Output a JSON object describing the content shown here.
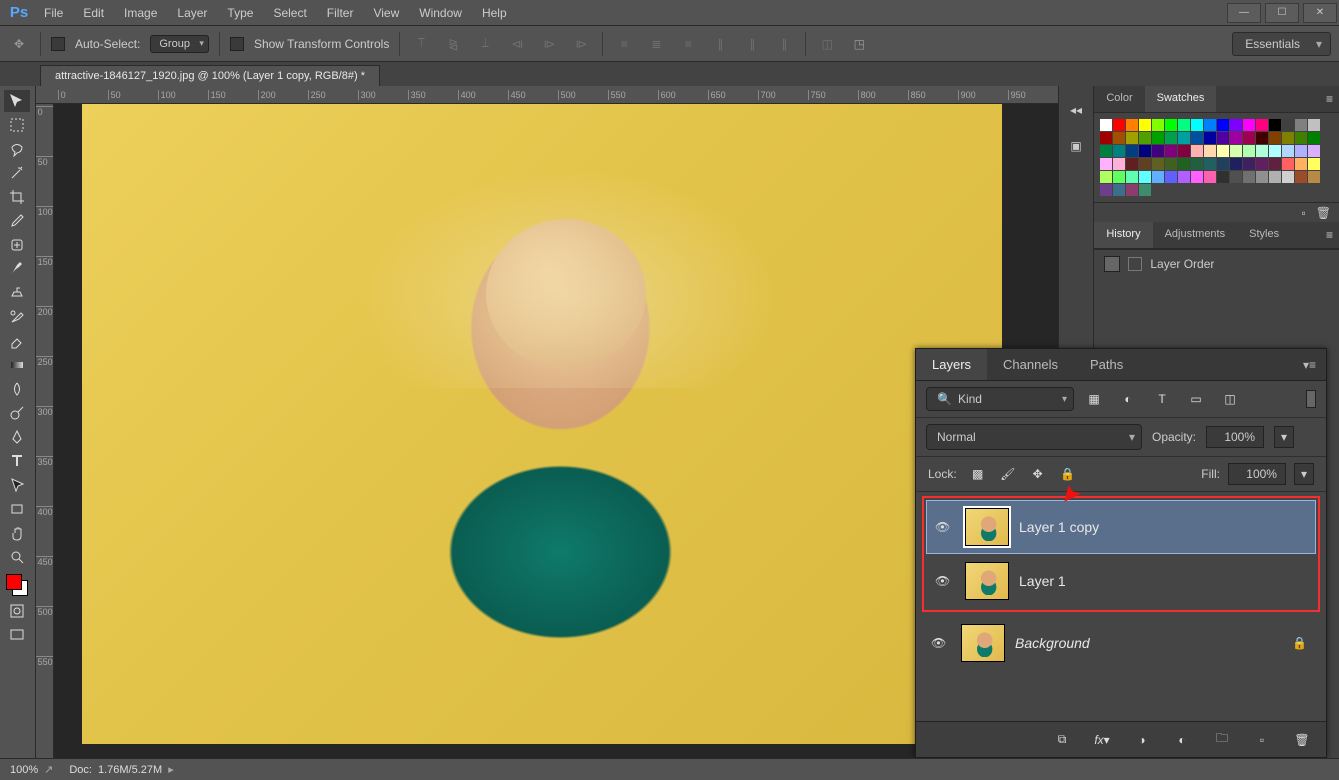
{
  "menu": {
    "items": [
      "File",
      "Edit",
      "Image",
      "Layer",
      "Type",
      "Select",
      "Filter",
      "View",
      "Window",
      "Help"
    ]
  },
  "options_bar": {
    "auto_select_label": "Auto-Select:",
    "auto_select_value": "Group",
    "show_transform_label": "Show Transform Controls"
  },
  "workspace": {
    "value": "Essentials"
  },
  "document": {
    "tab_title": "attractive-1846127_1920.jpg @ 100% (Layer 1 copy, RGB/8#) *"
  },
  "ruler": {
    "h": [
      "0",
      "50",
      "100",
      "150",
      "200",
      "250",
      "300",
      "350",
      "400",
      "450",
      "500",
      "550",
      "600",
      "650",
      "700",
      "750",
      "800",
      "850",
      "900",
      "950"
    ],
    "v": [
      "0",
      "50",
      "100",
      "150",
      "200",
      "250",
      "300",
      "350",
      "400",
      "450",
      "500",
      "550"
    ]
  },
  "panels": {
    "color_tabs": [
      "Color",
      "Swatches"
    ],
    "history_tabs": [
      "History",
      "Adjustments",
      "Styles"
    ],
    "history_item": "Layer Order"
  },
  "swatch_colors": [
    "#ffffff",
    "#ff0000",
    "#ff8000",
    "#ffff00",
    "#80ff00",
    "#00ff00",
    "#00ff80",
    "#00ffff",
    "#0080ff",
    "#0000ff",
    "#8000ff",
    "#ff00ff",
    "#ff0080",
    "#000000",
    "#404040",
    "#808080",
    "#c0c0c0",
    "#a00000",
    "#a05000",
    "#a0a000",
    "#50a000",
    "#00a000",
    "#00a050",
    "#00a0a0",
    "#0050a0",
    "#0000a0",
    "#5000a0",
    "#a000a0",
    "#a00050",
    "#400000",
    "#804000",
    "#808000",
    "#408000",
    "#008000",
    "#008040",
    "#008080",
    "#004080",
    "#000080",
    "#400080",
    "#800080",
    "#800040",
    "#ffb0b0",
    "#ffd8b0",
    "#ffffb0",
    "#d8ffb0",
    "#b0ffb0",
    "#b0ffd8",
    "#b0ffff",
    "#b0d8ff",
    "#b0b0ff",
    "#d8b0ff",
    "#ffb0ff",
    "#ffb0d8",
    "#602020",
    "#604020",
    "#606020",
    "#406020",
    "#206020",
    "#206040",
    "#206060",
    "#204060",
    "#202060",
    "#402060",
    "#602060",
    "#602040",
    "#ff6060",
    "#ffb060",
    "#ffff60",
    "#b0ff60",
    "#60ff60",
    "#60ffb0",
    "#60ffff",
    "#60b0ff",
    "#6060ff",
    "#b060ff",
    "#ff60ff",
    "#ff60b0",
    "#303030",
    "#505050",
    "#707070",
    "#909090",
    "#b0b0b0",
    "#d0d0d0",
    "#9a4d28",
    "#b78a45",
    "#6e3d8c",
    "#3d6e8c",
    "#8c3d6e",
    "#3d8c6e"
  ],
  "layers_panel": {
    "tabs": [
      "Layers",
      "Channels",
      "Paths"
    ],
    "filter_label": "Kind",
    "blend_mode": "Normal",
    "opacity_label": "Opacity:",
    "opacity_value": "100%",
    "lock_label": "Lock:",
    "fill_label": "Fill:",
    "fill_value": "100%",
    "layers": [
      {
        "name": "Layer 1 copy",
        "selected": true,
        "italic": false,
        "locked": false
      },
      {
        "name": "Layer 1",
        "selected": false,
        "italic": false,
        "locked": false
      },
      {
        "name": "Background",
        "selected": false,
        "italic": true,
        "locked": true
      }
    ]
  },
  "status": {
    "zoom": "100%",
    "doc_label": "Doc:",
    "doc_value": "1.76M/5.27M"
  }
}
